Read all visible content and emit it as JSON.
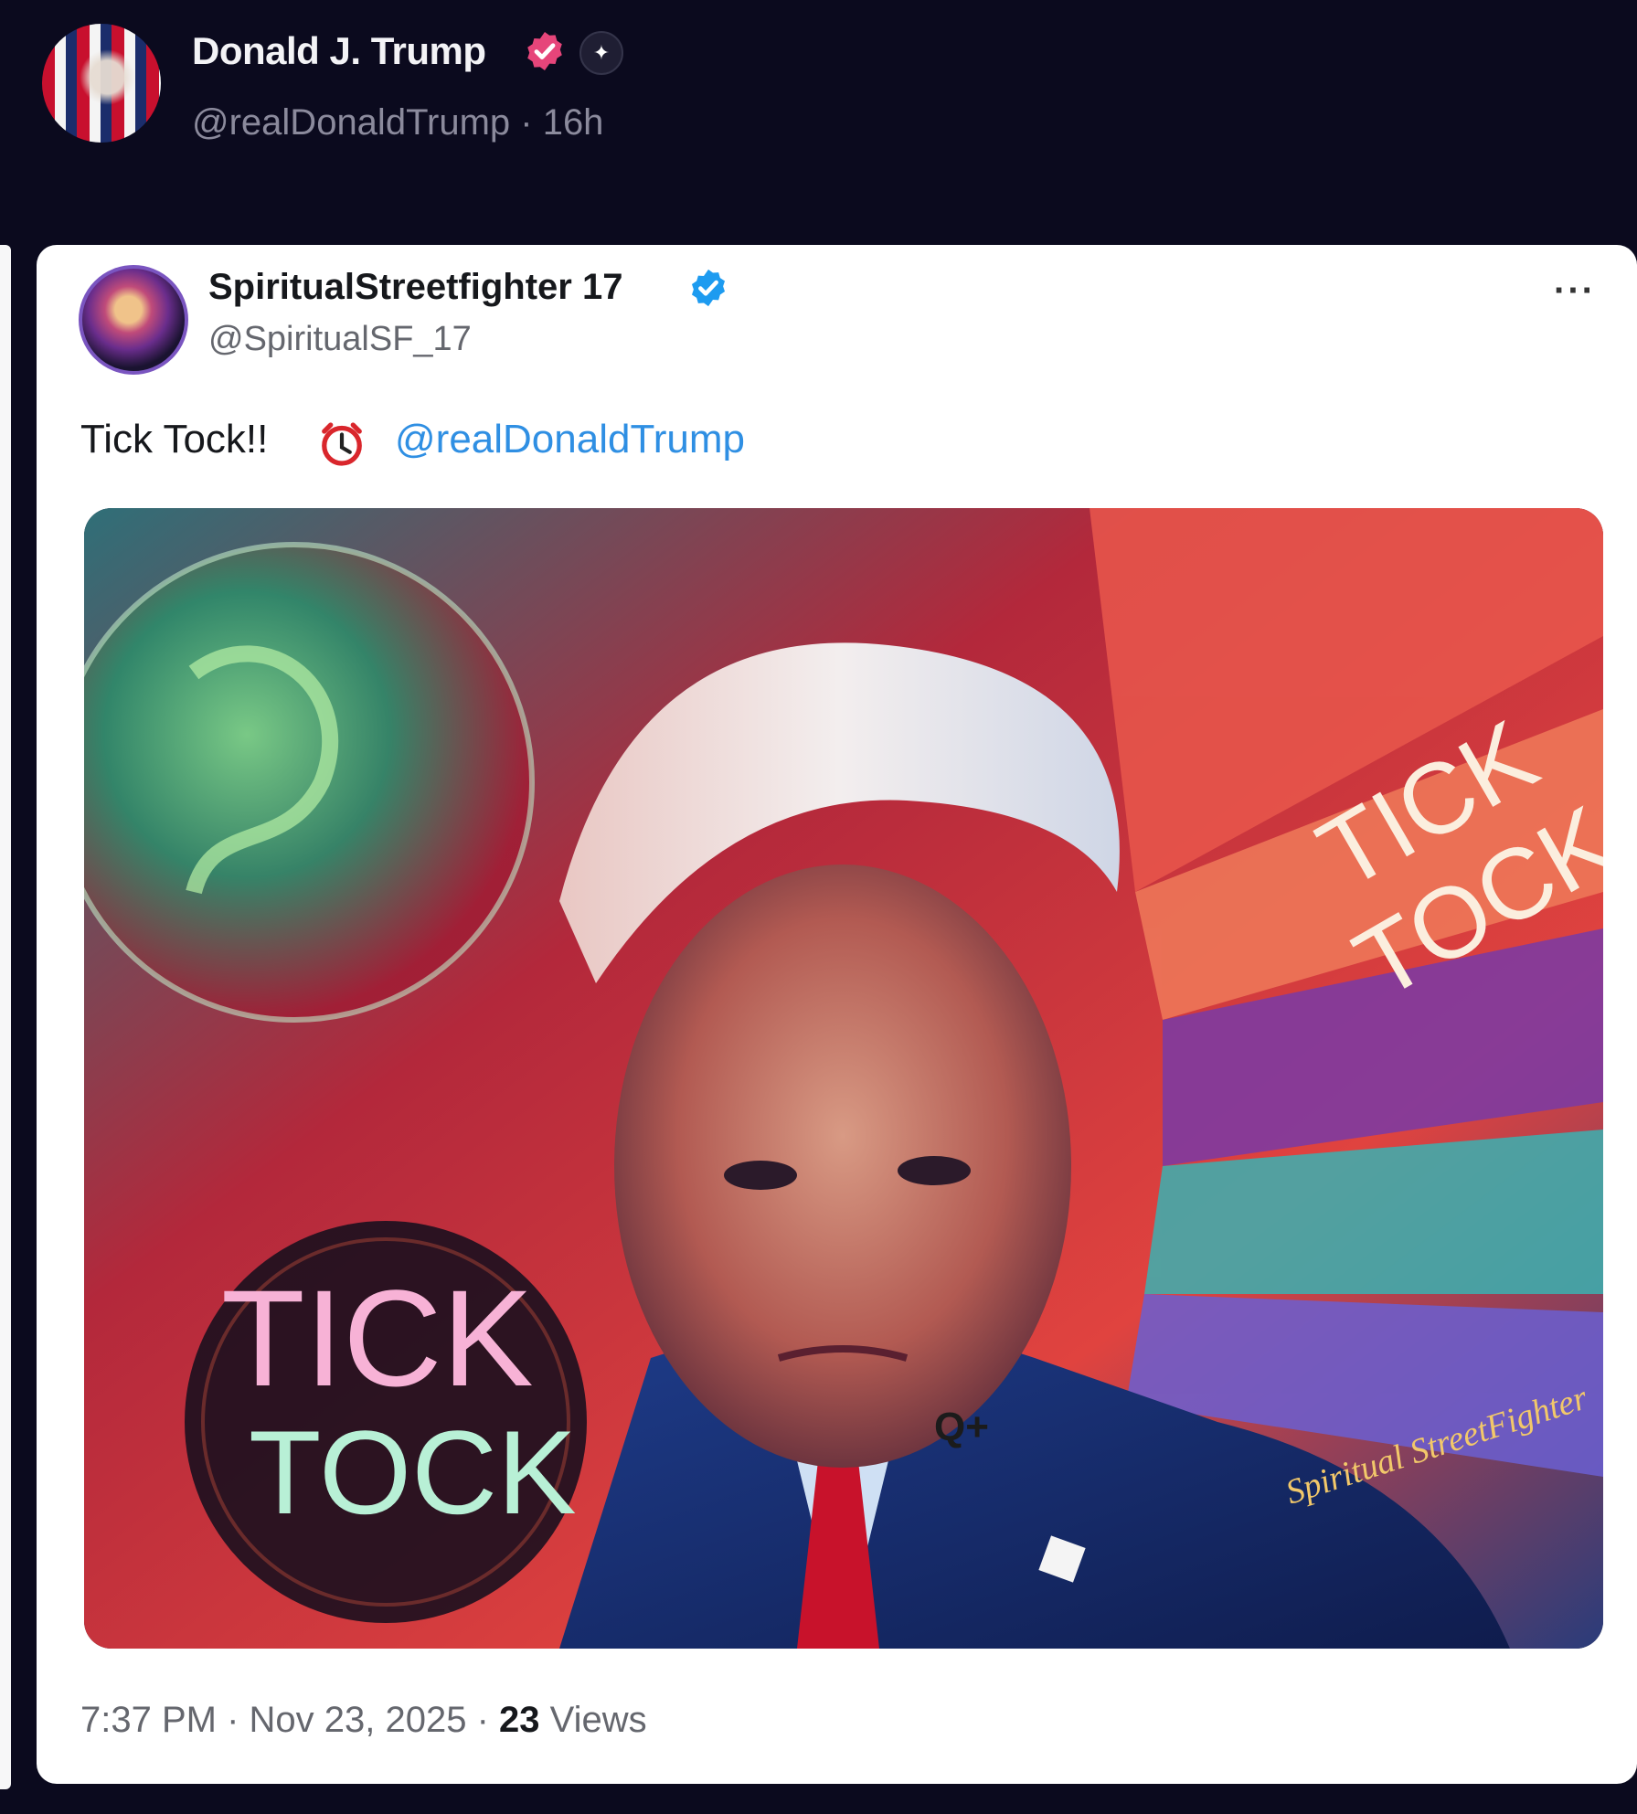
{
  "header": {
    "author_name": "Donald J. Trump",
    "author_meta": "@realDonaldTrump · 16h",
    "avatar_icon": "flag-portrait-avatar",
    "affiliation_icon": "sparkle-icon"
  },
  "quoted_post": {
    "display_name": "SpiritualStreetfighter 17",
    "handle": "@SpiritualSF_17",
    "more_label": "···",
    "text": "Tick Tock!!",
    "mention": "@realDonaldTrump",
    "clock_icon": "alarm-clock-icon",
    "media": {
      "text_right_line1": "TICK",
      "text_right_line2": "TOCK",
      "text_left_line1": "TICK",
      "text_left_line2": "TOCK",
      "lapel_pin": "Q+",
      "signature": "Spiritual StreetFighter"
    },
    "time": "7:37 PM · Nov 23, 2025 · ",
    "views_count": "23",
    "views_label": " Views"
  },
  "colors": {
    "page_bg": "#0b0a1e",
    "card_bg": "#ffffff",
    "link": "#2f8fe3",
    "verified_blue": "#1d9bf0",
    "verified_pink": "#e6457a"
  }
}
